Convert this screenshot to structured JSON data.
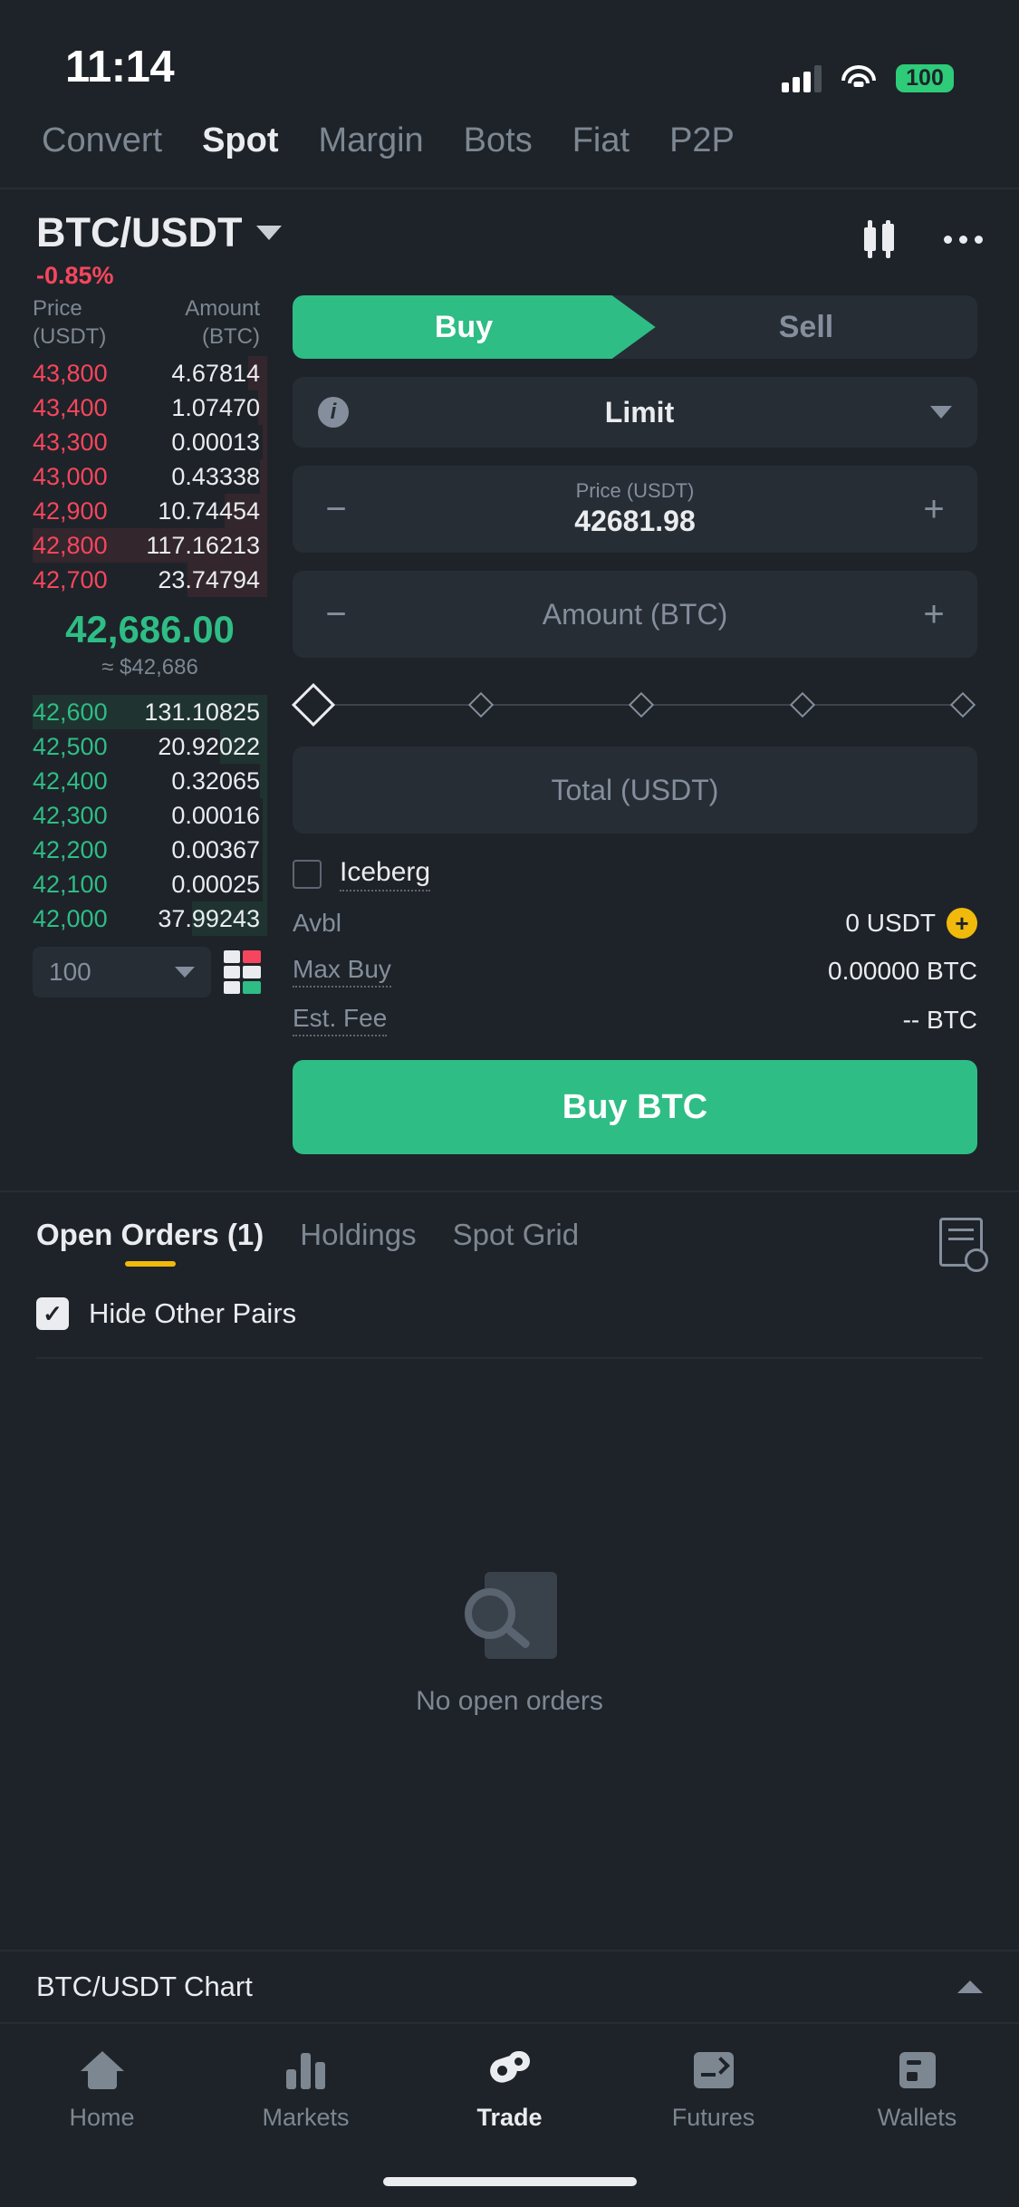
{
  "status_bar": {
    "time": "11:14",
    "battery": "100",
    "signal_icon": "cellular-signal-icon",
    "wifi_icon": "wifi-icon"
  },
  "top_tabs": [
    {
      "label": "Convert",
      "active": false
    },
    {
      "label": "Spot",
      "active": true
    },
    {
      "label": "Margin",
      "active": false
    },
    {
      "label": "Bots",
      "active": false
    },
    {
      "label": "Fiat",
      "active": false
    },
    {
      "label": "P2P",
      "active": false
    }
  ],
  "pair_header": {
    "pair": "BTC/USDT",
    "change_percent": "-0.85%",
    "change_color": "#f6465d",
    "chart_icon": "candlestick-chart-icon",
    "more_icon": "more-options-icon"
  },
  "order_book": {
    "header_price": "Price",
    "header_price_unit": "(USDT)",
    "header_amount": "Amount",
    "header_amount_unit": "(BTC)",
    "asks": [
      {
        "price": "43,800",
        "amount": "4.67814",
        "depth": 8
      },
      {
        "price": "43,400",
        "amount": "1.07470",
        "depth": 4
      },
      {
        "price": "43,300",
        "amount": "0.00013",
        "depth": 2
      },
      {
        "price": "43,000",
        "amount": "0.43338",
        "depth": 3
      },
      {
        "price": "42,900",
        "amount": "10.74454",
        "depth": 18
      },
      {
        "price": "42,800",
        "amount": "117.16213",
        "depth": 100
      },
      {
        "price": "42,700",
        "amount": "23.74794",
        "depth": 34
      }
    ],
    "mid_price": "42,686.00",
    "mid_price_usd": "≈ $42,686",
    "bids": [
      {
        "price": "42,600",
        "amount": "131.10825",
        "depth": 100
      },
      {
        "price": "42,500",
        "amount": "20.92022",
        "depth": 20
      },
      {
        "price": "42,400",
        "amount": "0.32065",
        "depth": 3
      },
      {
        "price": "42,300",
        "amount": "0.00016",
        "depth": 2
      },
      {
        "price": "42,200",
        "amount": "0.00367",
        "depth": 2
      },
      {
        "price": "42,100",
        "amount": "0.00025",
        "depth": 2
      },
      {
        "price": "42,000",
        "amount": "37.99243",
        "depth": 32
      }
    ],
    "depth_select_value": "100",
    "depth_view_icon": "order-book-layout-icon",
    "ask_color": "#f6465d",
    "bid_color": "#2ebd85"
  },
  "order_form": {
    "buy_label": "Buy",
    "sell_label": "Sell",
    "active_side": "Buy",
    "order_type": "Limit",
    "order_type_info_icon": "info-icon",
    "order_type_caret_icon": "chevron-down-icon",
    "price_label": "Price (USDT)",
    "price_value": "42681.98",
    "amount_placeholder": "Amount (BTC)",
    "amount_value": "",
    "minus_icon": "minus-icon",
    "plus_icon": "plus-icon",
    "slider_steps": [
      "0",
      "25",
      "50",
      "75",
      "100"
    ],
    "total_placeholder": "Total (USDT)",
    "iceberg_label": "Iceberg",
    "iceberg_checked": false,
    "avbl_label": "Avbl",
    "avbl_value": "0 USDT",
    "avbl_add_icon": "add-funds-icon",
    "max_buy_label": "Max Buy",
    "max_buy_value": "0.00000 BTC",
    "est_fee_label": "Est. Fee",
    "est_fee_value": "-- BTC",
    "submit_label": "Buy BTC",
    "accent_green": "#2ebd85"
  },
  "orders_section": {
    "tabs": [
      {
        "label": "Open Orders (1)",
        "active": true
      },
      {
        "label": "Holdings",
        "active": false
      },
      {
        "label": "Spot Grid",
        "active": false
      }
    ],
    "history_icon": "order-history-icon",
    "hide_other_pairs_label": "Hide Other Pairs",
    "hide_other_pairs_checked": true,
    "checkmark": "✓",
    "empty_icon": "no-orders-search-icon",
    "empty_text": "No open orders"
  },
  "chart_bar": {
    "label": "BTC/USDT Chart",
    "expand_icon": "chevron-up-icon"
  },
  "bottom_nav": [
    {
      "label": "Home",
      "icon": "home-icon",
      "active": false
    },
    {
      "label": "Markets",
      "icon": "markets-bars-icon",
      "active": false
    },
    {
      "label": "Trade",
      "icon": "trade-icon",
      "active": true
    },
    {
      "label": "Futures",
      "icon": "futures-icon",
      "active": false
    },
    {
      "label": "Wallets",
      "icon": "wallet-icon",
      "active": false
    }
  ]
}
